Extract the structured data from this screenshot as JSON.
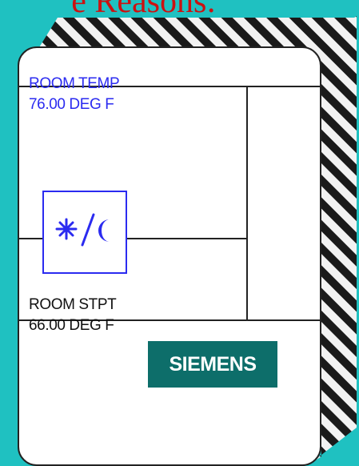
{
  "slide": {
    "title_fragment": "e Reasons:"
  },
  "device": {
    "room_temp": {
      "label": "ROOM TEMP",
      "value": "76.00 DEG F"
    },
    "room_setpoint": {
      "label": "ROOM STPT",
      "value": "66.00 DEG F"
    },
    "mode_toggle": {
      "icon": "sun-moon-icon",
      "color": "#2b2bf0"
    },
    "brand": "SIEMENS"
  },
  "colors": {
    "background": "#1fc1c1",
    "title": "#cc1111",
    "accent_blue": "#2b2bf0",
    "brand_bg": "#0d6e6a"
  }
}
